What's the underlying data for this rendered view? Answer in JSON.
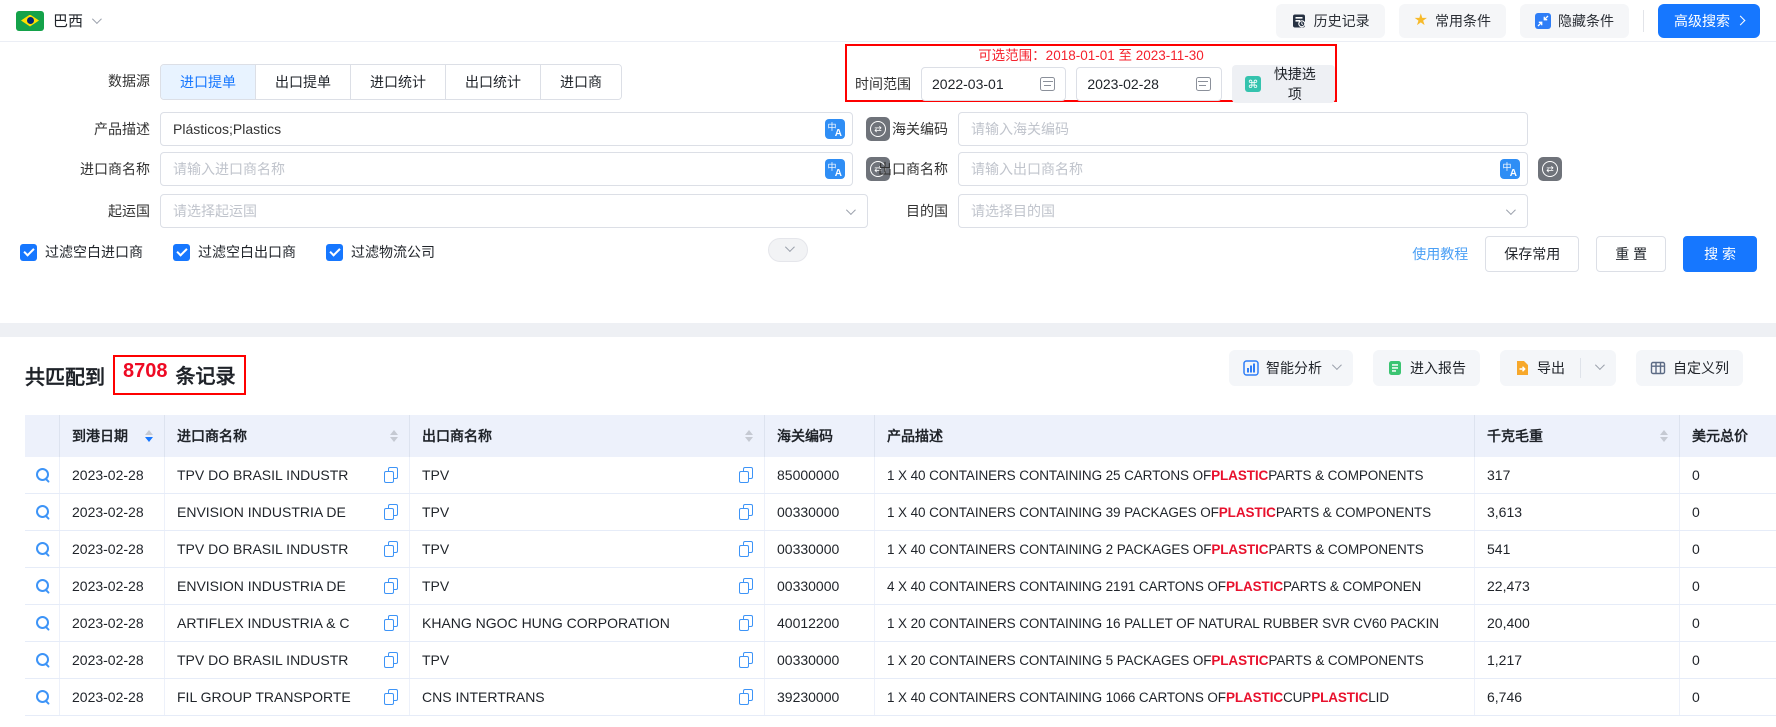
{
  "topbar": {
    "country": "巴西",
    "history_label": "历史记录",
    "favorites_label": "常用条件",
    "hide_label": "隐藏条件",
    "advanced_label": "高级搜索"
  },
  "search": {
    "datasource_label": "数据源",
    "tabs": [
      {
        "label": "进口提单",
        "active": true
      },
      {
        "label": "出口提单",
        "active": false
      },
      {
        "label": "进口统计",
        "active": false
      },
      {
        "label": "出口统计",
        "active": false
      },
      {
        "label": "进口商",
        "active": false
      }
    ],
    "time": {
      "hint": "可选范围：2018-01-01 至 2023-11-30",
      "label": "时间范围",
      "start": "2022-03-01",
      "end": "2023-02-28",
      "quick": "快捷选项"
    },
    "fields": {
      "product_desc": {
        "label": "产品描述",
        "value": "Plásticos;Plastics"
      },
      "hs_code": {
        "label": "海关编码",
        "placeholder": "请输入海关编码"
      },
      "importer": {
        "label": "进口商名称",
        "placeholder": "请输入进口商名称"
      },
      "exporter": {
        "label": "出口商名称",
        "placeholder": "请输入出口商名称"
      },
      "origin": {
        "label": "起运国",
        "placeholder": "请选择起运国"
      },
      "destination": {
        "label": "目的国",
        "placeholder": "请选择目的国"
      }
    },
    "checkboxes": [
      {
        "label": "过滤空白进口商",
        "checked": true
      },
      {
        "label": "过滤空白出口商",
        "checked": true
      },
      {
        "label": "过滤物流公司",
        "checked": true
      }
    ],
    "actions": {
      "tutorial": "使用教程",
      "save": "保存常用",
      "reset": "重 置",
      "search": "搜 索"
    }
  },
  "results": {
    "count_prefix": "共匹配到",
    "count": "8708",
    "count_suffix": "条记录",
    "toolbar": {
      "analysis": "智能分析",
      "report": "进入报告",
      "export": "导出",
      "columns": "自定义列"
    },
    "table": {
      "columns": [
        {
          "label": "",
          "sortable": false
        },
        {
          "label": "到港日期",
          "sortable": true,
          "sort": "desc"
        },
        {
          "label": "进口商名称",
          "sortable": true,
          "sort": null
        },
        {
          "label": "出口商名称",
          "sortable": true,
          "sort": null
        },
        {
          "label": "海关编码",
          "sortable": false
        },
        {
          "label": "产品描述",
          "sortable": false
        },
        {
          "label": "千克毛重",
          "sortable": true,
          "sort": null
        },
        {
          "label": "美元总价",
          "sortable": false
        }
      ],
      "highlight_terms": [
        "PLASTIC"
      ],
      "rows": [
        {
          "date": "2023-02-28",
          "importer": "TPV DO BRASIL INDUSTR",
          "exporter": "TPV",
          "hs_code": "85000000",
          "description": "1 X 40 CONTAINERS CONTAINING 25 CARTONS OF PLASTIC PARTS & COMPONENTS",
          "weight_kg": "317",
          "value_usd": "0"
        },
        {
          "date": "2023-02-28",
          "importer": "ENVISION INDUSTRIA DE",
          "exporter": "TPV",
          "hs_code": "00330000",
          "description": "1 X 40 CONTAINERS CONTAINING 39 PACKAGES OF PLASTIC PARTS & COMPONENTS",
          "weight_kg": "3,613",
          "value_usd": "0"
        },
        {
          "date": "2023-02-28",
          "importer": "TPV DO BRASIL INDUSTR",
          "exporter": "TPV",
          "hs_code": "00330000",
          "description": "1 X 40 CONTAINERS CONTAINING 2 PACKAGES OF PLASTIC PARTS & COMPONENTS",
          "weight_kg": "541",
          "value_usd": "0"
        },
        {
          "date": "2023-02-28",
          "importer": "ENVISION INDUSTRIA DE",
          "exporter": "TPV",
          "hs_code": "00330000",
          "description": "4 X 40 CONTAINERS CONTAINING 2191 CARTONS OF PLASTIC PARTS & COMPONEN",
          "weight_kg": "22,473",
          "value_usd": "0"
        },
        {
          "date": "2023-02-28",
          "importer": "ARTIFLEX INDUSTRIA & C",
          "exporter": "KHANG NGOC HUNG CORPORATION",
          "hs_code": "40012200",
          "description": "1 X 20 CONTAINERS CONTAINING 16 PALLET OF NATURAL RUBBER SVR CV60 PACKIN",
          "weight_kg": "20,400",
          "value_usd": "0"
        },
        {
          "date": "2023-02-28",
          "importer": "TPV DO BRASIL INDUSTR",
          "exporter": "TPV",
          "hs_code": "00330000",
          "description": "1 X 20 CONTAINERS CONTAINING 5 PACKAGES OF PLASTIC PARTS & COMPONENTS",
          "weight_kg": "1,217",
          "value_usd": "0"
        },
        {
          "date": "2023-02-28",
          "importer": "FIL GROUP TRANSPORTE",
          "exporter": "CNS INTERTRANS",
          "hs_code": "39230000",
          "description": "1 X 40 CONTAINERS CONTAINING 1066 CARTONS OF PLASTIC CUP PLASTIC LID",
          "weight_kg": "6,746",
          "value_usd": "0"
        }
      ]
    }
  },
  "colors": {
    "primary_blue": "#1677ff",
    "annotation_red": "#fe0000",
    "highlight_red": "#e8112d",
    "count_red": "#ee0a24",
    "table_header_bg": "#edf1fb",
    "tab_active_bg": "#e8f3ff",
    "button_gray_bg": "#f5f6f8",
    "star_yellow": "#f7ba2a",
    "quick_icon_teal": "#35c3ae"
  },
  "icons": {
    "swap_glyph": "⇄",
    "quick_glyph": "⌘",
    "star_glyph": "★"
  }
}
